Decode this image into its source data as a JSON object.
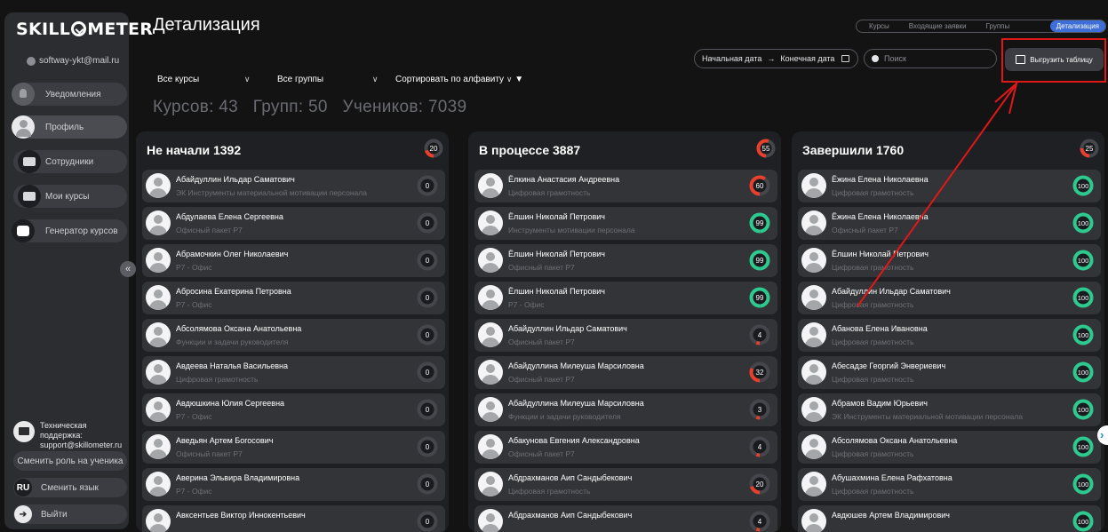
{
  "sidebar": {
    "logo": "SKILLOMETER",
    "user_email": "softway-ykt@mail.ru",
    "items": [
      {
        "label": "Уведомления",
        "icon": "bell-icon"
      },
      {
        "label": "Профиль",
        "icon": "profile-icon"
      },
      {
        "label": "Сотрудники",
        "icon": "employees-icon"
      },
      {
        "label": "Мои курсы",
        "icon": "courses-icon"
      },
      {
        "label": "Генератор курсов",
        "icon": "generator-icon"
      }
    ],
    "support_label": "Техническая поддержка:",
    "support_email": "support@skillometer.ru",
    "switch_role": "Сменить роль на ученика",
    "lang_code": "RU",
    "lang_label": "Сменить язык",
    "logout": "Выйти"
  },
  "header": {
    "title": "Детализация",
    "tabs": [
      "Курсы",
      "Входящие заявки",
      "Группы",
      "Детализация"
    ],
    "active_tab": "Детализация",
    "start_date": "Начальная дата",
    "date_arrow": "→",
    "end_date": "Конечная дата",
    "search_placeholder": "Поиск",
    "export_label": "Выгрузить таблицу"
  },
  "filters": {
    "courses": "Все курсы",
    "groups": "Все группы",
    "sort": "Сортировать по алфавиту"
  },
  "stats": {
    "text": "Курсов: 43   Групп: 50   Учеников: 7039"
  },
  "colors": {
    "accent_blue": "#3e6fd8",
    "progress_red": "#e8402c",
    "complete_green": "#2ec98f",
    "annotation_red": "#e01818"
  },
  "columns": [
    {
      "title": "Не начали 1392",
      "badge": 20,
      "rows": [
        {
          "name": "Абайдуллин Ильдар Саматович",
          "course": "ЭК Инструменты материальной мотивации персонала",
          "value": 0
        },
        {
          "name": "Абдулаева Елена Сергеевна",
          "course": "Офисный пакет Р7",
          "value": 0
        },
        {
          "name": "Абрамочкин Олег Николаевич",
          "course": "Р7 - Офис",
          "value": 0
        },
        {
          "name": "Абросина Екатерина Петровна",
          "course": "Р7 - Офис",
          "value": 0
        },
        {
          "name": "Абсолямова Оксана Анатольевна",
          "course": "Функции и задачи руководителя",
          "value": 0
        },
        {
          "name": "Авдеева Наталья Васильевна",
          "course": "Цифровая грамотность",
          "value": 0
        },
        {
          "name": "Авдюшкина Юлия Сергеевна",
          "course": "Р7 - Офис",
          "value": 0
        },
        {
          "name": "Аведьян Артем Богосович",
          "course": "Офисный пакет Р7",
          "value": 0
        },
        {
          "name": "Аверина Эльвира Владимировна",
          "course": "Р7 - Офис",
          "value": 0
        },
        {
          "name": "Авксентьев Виктор Иннокентьевич",
          "course": "",
          "value": 0
        }
      ]
    },
    {
      "title": "В процессе 3887",
      "badge": 55,
      "rows": [
        {
          "name": "Ёлкина Анастасия Андреевна",
          "course": "Цифровая грамотность",
          "value": 60
        },
        {
          "name": "Ёлшин Николай Петрович",
          "course": "Инструменты мотивации персонала",
          "value": 99
        },
        {
          "name": "Ёлшин Николай Петрович",
          "course": "Офисный пакет Р7",
          "value": 99
        },
        {
          "name": "Ёлшин Николай Петрович",
          "course": "Р7 - Офис",
          "value": 99
        },
        {
          "name": "Абайдуллин Ильдар Саматович",
          "course": "Офисный пакет Р7",
          "value": 4
        },
        {
          "name": "Абайдуллина Милеуша Марсиловна",
          "course": "Офисный пакет Р7",
          "value": 32
        },
        {
          "name": "Абайдуллина Милеуша Марсиловна",
          "course": "Функции и задачи руководителя",
          "value": 3
        },
        {
          "name": "Абакунова Евгения Александровна",
          "course": "Офисный пакет Р7",
          "value": 4
        },
        {
          "name": "Абдрахманов Аип Сандыбекович",
          "course": "Цифровая грамотность",
          "value": 20
        },
        {
          "name": "Абдрахманов Аип Сандыбекович",
          "course": "",
          "value": 4
        }
      ]
    },
    {
      "title": "Завершили 1760",
      "badge": 25,
      "rows": [
        {
          "name": "Ёжина Елена Николаевна",
          "course": "Цифровая грамотность",
          "value": 100
        },
        {
          "name": "Ёжина Елена Николаевна",
          "course": "Офисный пакет Р7",
          "value": 100
        },
        {
          "name": "Ёлшин Николай Петрович",
          "course": "Цифровая грамотность",
          "value": 100
        },
        {
          "name": "Абайдуллин Ильдар Саматович",
          "course": "Цифровая грамотность",
          "value": 100
        },
        {
          "name": "Абанова Елена Ивановна",
          "course": "Цифровая грамотность",
          "value": 100
        },
        {
          "name": "Абесадзе Георгий Энвериевич",
          "course": "Цифровая грамотность",
          "value": 100
        },
        {
          "name": "Абрамов Вадим Юрьевич",
          "course": "ЭК Инструменты материальной мотивации персонала",
          "value": 100
        },
        {
          "name": "Абсолямова Оксана Анатольевна",
          "course": "Цифровая грамотность",
          "value": 100
        },
        {
          "name": "Абушахмина Елена Рафхатовна",
          "course": "Цифровая грамотность",
          "value": 100
        },
        {
          "name": "Авдюшев Артем Владимирович",
          "course": "",
          "value": 100
        }
      ]
    }
  ]
}
